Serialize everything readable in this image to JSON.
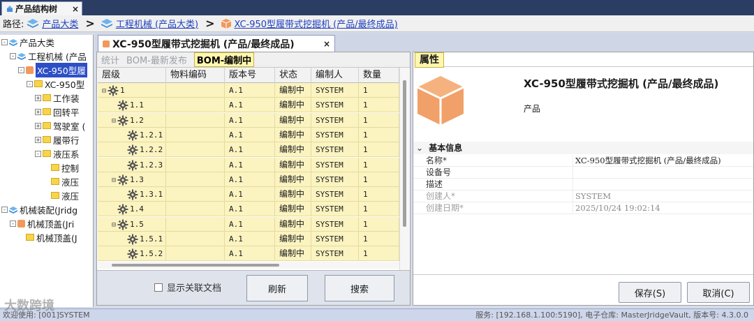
{
  "top_tab": {
    "title": "产品结构树",
    "close": "×"
  },
  "breadcrumb": {
    "label": "路径:",
    "items": [
      "产品大类",
      "工程机械 (产品大类)",
      "XC-950型履带式挖掘机 (产品/最终成品)"
    ],
    "separator": ">"
  },
  "tree": {
    "nodes": [
      {
        "label": "产品大类",
        "level": 0,
        "expander": "-",
        "icon": "stack-icon"
      },
      {
        "label": "工程机械 (产品",
        "level": 1,
        "expander": "-",
        "icon": "stack-icon"
      },
      {
        "label": "XC-950型履",
        "level": 2,
        "expander": "-",
        "icon": "box-icon",
        "selected": true
      },
      {
        "label": "XC-950型",
        "level": 3,
        "expander": "-",
        "icon": "folder-icon"
      },
      {
        "label": "工作装",
        "level": 4,
        "expander": "+",
        "icon": "folder-icon"
      },
      {
        "label": "回转平",
        "level": 4,
        "expander": "+",
        "icon": "folder-icon"
      },
      {
        "label": "驾驶室 (",
        "level": 4,
        "expander": "+",
        "icon": "folder-icon"
      },
      {
        "label": "履带行",
        "level": 4,
        "expander": "+",
        "icon": "folder-icon"
      },
      {
        "label": "液压系",
        "level": 4,
        "expander": "-",
        "icon": "folder-icon"
      },
      {
        "label": "控制",
        "level": 5,
        "expander": "",
        "icon": "folder-icon"
      },
      {
        "label": "液压",
        "level": 5,
        "expander": "",
        "icon": "folder-icon"
      },
      {
        "label": "液压",
        "level": 5,
        "expander": "",
        "icon": "folder-icon"
      },
      {
        "label": "机械装配(Jridg",
        "level": 0,
        "expander": "-",
        "icon": "stack-icon"
      },
      {
        "label": "机械顶盖(Jri",
        "level": 1,
        "expander": "-",
        "icon": "box-icon"
      },
      {
        "label": "机械顶盖(J",
        "level": 2,
        "expander": "",
        "icon": "folder-icon"
      }
    ]
  },
  "center_tab": {
    "title": "XC-950型履带式挖掘机 (产品/最终成品)",
    "close": "×"
  },
  "sub_tabs": [
    {
      "label": "统计",
      "active": false
    },
    {
      "label": "BOM-最新发布",
      "active": false
    },
    {
      "label": "BOM-编制中",
      "active": true
    }
  ],
  "grid": {
    "columns": [
      "层级",
      "物料编码",
      "版本号",
      "状态",
      "编制人",
      "数量"
    ],
    "rows": [
      {
        "level": "1",
        "indent": 0,
        "toggle": "⊟",
        "code": "",
        "version": "A.1",
        "status": "编制中",
        "author": "SYSTEM",
        "qty": "1"
      },
      {
        "level": "1.1",
        "indent": 1,
        "toggle": "",
        "code": "",
        "version": "A.1",
        "status": "编制中",
        "author": "SYSTEM",
        "qty": "1"
      },
      {
        "level": "1.2",
        "indent": 1,
        "toggle": "⊟",
        "code": "",
        "version": "A.1",
        "status": "编制中",
        "author": "SYSTEM",
        "qty": "1"
      },
      {
        "level": "1.2.1",
        "indent": 2,
        "toggle": "",
        "code": "",
        "version": "A.1",
        "status": "编制中",
        "author": "SYSTEM",
        "qty": "1"
      },
      {
        "level": "1.2.2",
        "indent": 2,
        "toggle": "",
        "code": "",
        "version": "A.1",
        "status": "编制中",
        "author": "SYSTEM",
        "qty": "1"
      },
      {
        "level": "1.2.3",
        "indent": 2,
        "toggle": "",
        "code": "",
        "version": "A.1",
        "status": "编制中",
        "author": "SYSTEM",
        "qty": "1"
      },
      {
        "level": "1.3",
        "indent": 1,
        "toggle": "⊟",
        "code": "",
        "version": "A.1",
        "status": "编制中",
        "author": "SYSTEM",
        "qty": "1"
      },
      {
        "level": "1.3.1",
        "indent": 2,
        "toggle": "",
        "code": "",
        "version": "A.1",
        "status": "编制中",
        "author": "SYSTEM",
        "qty": "1"
      },
      {
        "level": "1.4",
        "indent": 1,
        "toggle": "",
        "code": "",
        "version": "A.1",
        "status": "编制中",
        "author": "SYSTEM",
        "qty": "1"
      },
      {
        "level": "1.5",
        "indent": 1,
        "toggle": "⊟",
        "code": "",
        "version": "A.1",
        "status": "编制中",
        "author": "SYSTEM",
        "qty": "1"
      },
      {
        "level": "1.5.1",
        "indent": 2,
        "toggle": "",
        "code": "",
        "version": "A.1",
        "status": "编制中",
        "author": "SYSTEM",
        "qty": "1"
      },
      {
        "level": "1.5.2",
        "indent": 2,
        "toggle": "",
        "code": "",
        "version": "A.1",
        "status": "编制中",
        "author": "SYSTEM",
        "qty": "1"
      }
    ]
  },
  "center_footer": {
    "show_docs_label": "显示关联文档",
    "show_docs_checked": false,
    "refresh_label": "刷新",
    "search_label": "搜索"
  },
  "props": {
    "tab_label": "属性",
    "title": "XC-950型履带式挖掘机 (产品/最终成品)",
    "type": "产品",
    "group_label": "基本信息",
    "group_toggle": "⌄",
    "rows": [
      {
        "key": "名称*",
        "value": "XC-950型履带式挖掘机 (产品/最终成品)",
        "muted": false
      },
      {
        "key": "设备号",
        "value": "",
        "muted": false
      },
      {
        "key": "描述",
        "value": "",
        "muted": false
      },
      {
        "key": "创建人*",
        "value": "SYSTEM",
        "muted": true
      },
      {
        "key": "创建日期*",
        "value": "2025/10/24 19:02:14",
        "muted": true
      }
    ],
    "save_label": "保存(S)",
    "cancel_label": "取消(C)"
  },
  "status_bar": {
    "left": "欢迎使用: [001]SYSTEM",
    "right": "服务: [192.168.1.100:5190], 电子仓库: MasterJridgeVault, 版本号: 4.3.0.0"
  },
  "watermark": "大数跨境",
  "colors": {
    "row_bg": "#fbf3c0",
    "selection": "#2d4fc6",
    "link": "#1f3fbf",
    "product_orange": "#f0995c",
    "tab_strip": "#2b3d63"
  }
}
